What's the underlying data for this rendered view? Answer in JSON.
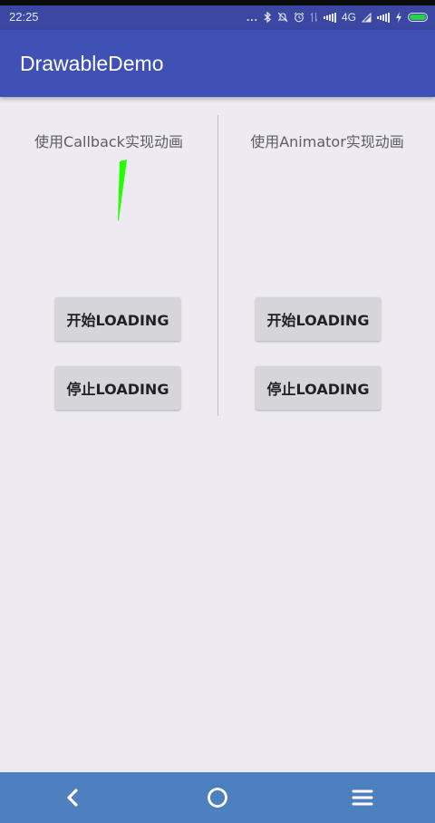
{
  "status_bar": {
    "time": "22:25",
    "dots": "...",
    "network": "4G"
  },
  "app_bar": {
    "title": "DrawableDemo"
  },
  "panels": [
    {
      "label": "使用Callback实现动画",
      "start_label": "开始LOADING",
      "stop_label": "停止LOADING"
    },
    {
      "label": "使用Animator实现动画",
      "start_label": "开始LOADING",
      "stop_label": "停止LOADING"
    }
  ],
  "nav_bar": {
    "icons": [
      "back-icon",
      "home-icon",
      "menu-icon"
    ]
  },
  "colors": {
    "status_bar": "#3a48a4",
    "app_bar": "#3f51b5",
    "background": "#edebf1",
    "nav_bar": "#4e7fbf",
    "loading_spinner": "#22ff00"
  }
}
